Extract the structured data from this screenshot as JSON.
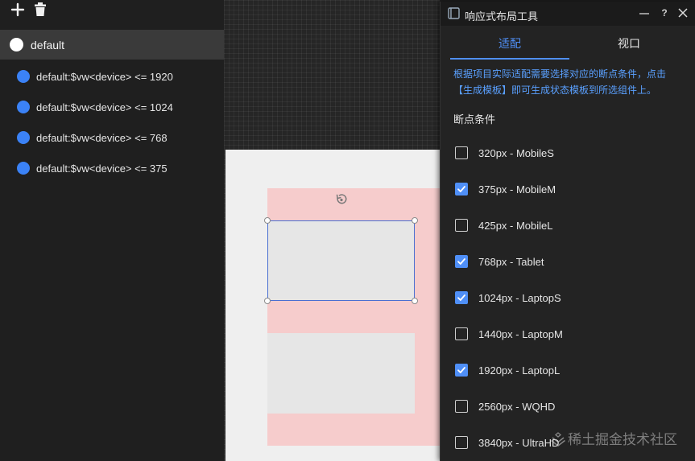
{
  "states": [
    {
      "label": "default"
    },
    {
      "label": "default:$vw<device> <= 1920"
    },
    {
      "label": "default:$vw<device> <= 1024"
    },
    {
      "label": "default:$vw<device> <= 768"
    },
    {
      "label": "default:$vw<device> <= 375"
    }
  ],
  "dialog": {
    "title": "响应式布局工具",
    "help_label": "?",
    "tabs": [
      {
        "label": "适配"
      },
      {
        "label": "视口"
      }
    ],
    "active_tab": "适配",
    "hint": "根据项目实际适配需要选择对应的断点条件，点击【生成模板】即可生成状态模板到所选组件上。",
    "section_title": "断点条件",
    "breakpoints": [
      {
        "label": "320px - MobileS",
        "checked": false
      },
      {
        "label": "375px - MobileM",
        "checked": true
      },
      {
        "label": "425px - MobileL",
        "checked": false
      },
      {
        "label": "768px - Tablet",
        "checked": true
      },
      {
        "label": "1024px - LaptopS",
        "checked": true
      },
      {
        "label": "1440px - LaptopM",
        "checked": false
      },
      {
        "label": "1920px - LaptopL",
        "checked": true
      },
      {
        "label": "2560px - WQHD",
        "checked": false
      },
      {
        "label": "3840px - UltraHD",
        "checked": false
      }
    ]
  },
  "watermark": "稀土掘金技术社区",
  "colors": {
    "accent": "#4f8ff7",
    "state_dot": "#3b82f6",
    "container_fill": "#f6cccc",
    "selection_border": "#4a6fd1"
  }
}
